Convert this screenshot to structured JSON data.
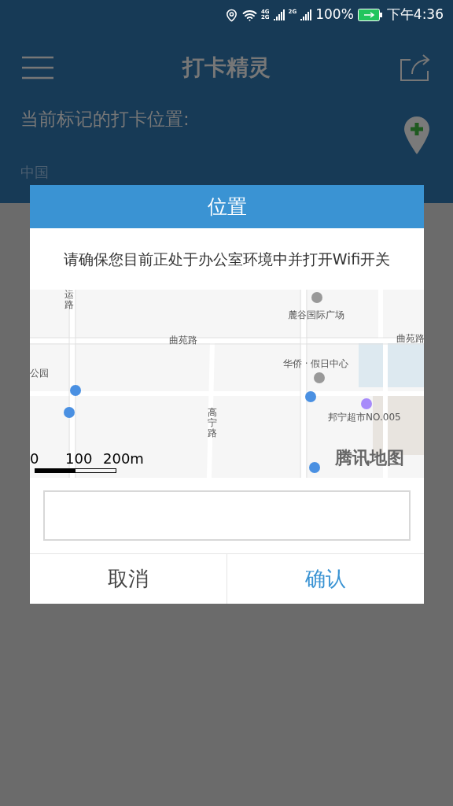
{
  "status_bar": {
    "network_1_top": "4G",
    "network_1_bottom": "2G",
    "network_2": "2G",
    "battery": "100%",
    "time": "下午4:36"
  },
  "app_bar": {
    "title": "打卡精灵"
  },
  "location": {
    "label": "当前标记的打卡位置:",
    "value": "中国"
  },
  "dialog": {
    "title": "位置",
    "message": "请确保您目前正处于办公室环境中并打开Wifi开关",
    "map": {
      "labels": [
        {
          "text": "运路",
          "kind": "vertical"
        },
        {
          "text": "麓谷国际广场",
          "kind": "horizontal"
        },
        {
          "text": "曲苑路",
          "kind": "horizontal"
        },
        {
          "text": "曲苑路",
          "kind": "horizontal"
        },
        {
          "text": "华侨 · 假日中心",
          "kind": "horizontal"
        },
        {
          "text": "公园",
          "kind": "horizontal"
        },
        {
          "text": "高宁路",
          "kind": "vertical"
        },
        {
          "text": "邦宁超市NO.005",
          "kind": "horizontal"
        }
      ],
      "scale": [
        "0",
        "100",
        "200m"
      ],
      "logo": "腾讯地图"
    },
    "buttons": [
      {
        "label": "取消",
        "kind": "cancel"
      },
      {
        "label": "确认",
        "kind": "confirm"
      }
    ]
  }
}
